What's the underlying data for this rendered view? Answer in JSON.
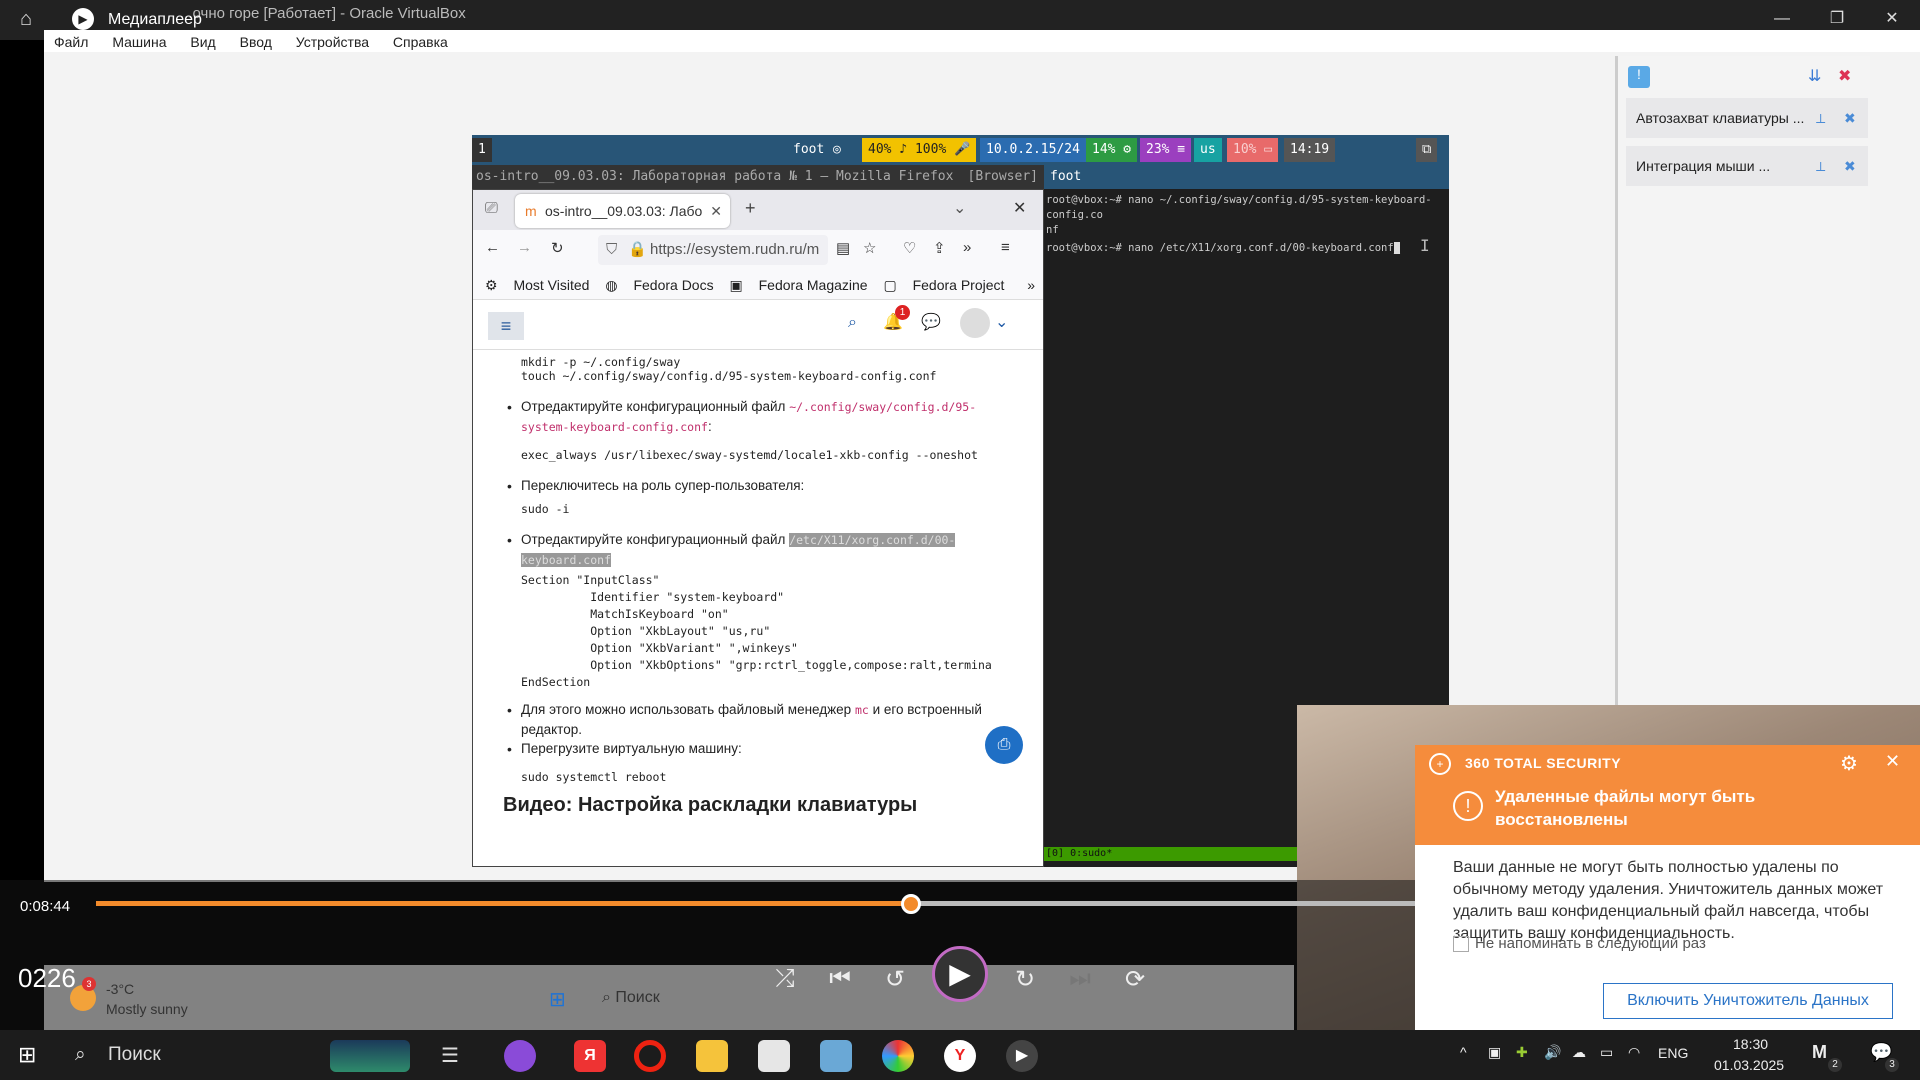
{
  "player": {
    "title": "Медиаплеер",
    "behind_title": "...очно горе [Работает] - Oracle VirtualBox",
    "current_time": "0:08:44",
    "clock_overlay": "0226",
    "progress_fraction": 0.45,
    "accent": "#f38b2b"
  },
  "vbox": {
    "menu": [
      "Файл",
      "Машина",
      "Вид",
      "Ввод",
      "Устройства",
      "Справка"
    ],
    "side_items": [
      "Автозахват клавиатуры ...",
      "Интеграция мыши ..."
    ]
  },
  "sway": {
    "workspace": "1",
    "foot": "foot",
    "audio": "40%",
    "volume": "100%",
    "ip": "10.0.2.15/24",
    "cpu": "14%",
    "mem": "23%",
    "layout": "us",
    "battery": "10%",
    "time": "14:19"
  },
  "firefox": {
    "window_title": "os-intro__09.03.03: Лабораторная работа № 1 — Mozilla Firefox",
    "window_tag": "[Browser]",
    "tab_label": "os-intro__09.03.03: Лабо",
    "url": "https://esystem.rudn.ru/m",
    "bookmarks": [
      "Most Visited",
      "Fedora Docs",
      "Fedora Magazine",
      "Fedora Project"
    ],
    "notif_count": "1"
  },
  "page": {
    "code1": "mkdir -p ~/.config/sway\ntouch ~/.config/sway/config.d/95-system-keyboard-config.conf",
    "b1_text": "Отредактируйте конфигурационный файл ",
    "b1_path": "~/.config/sway/config.d/95-system-keyboard-config.conf",
    "code2": "exec_always /usr/libexec/sway-systemd/locale1-xkb-config --oneshot",
    "b2_text": "Переключитесь на роль супер-пользователя:",
    "code3": "sudo -i",
    "b3_text": "Отредактируйте конфигурационный файл ",
    "b3_path": "/etc/X11/xorg.conf.d/00-keyboard.conf",
    "code4": "Section \"InputClass\"\n          Identifier \"system-keyboard\"\n          MatchIsKeyboard \"on\"\n          Option \"XkbLayout\" \"us,ru\"\n          Option \"XkbVariant\" \",winkeys\"\n          Option \"XkbOptions\" \"grp:rctrl_toggle,compose:ralt,termina\nEndSection",
    "b4_text": "Для этого можно использовать файловый менеджер ",
    "b4_mc": "mc",
    "b4_rest": " и его встроенный редактор.",
    "b5_text": "Перегрузите виртуальную машину:",
    "code5": "sudo systemctl reboot",
    "cut_heading": "Видео: Настройка раскладки клавиатуры"
  },
  "terminal": {
    "title": "foot",
    "line1": "root@vbox:~# nano ~/.config/sway/config.d/95-system-keyboard-config.co",
    "line2": "nf",
    "line3": "root@vbox:~# nano /etc/X11/xorg.conf.d/00-keyboard.conf",
    "status": "[0] 0:sudo*"
  },
  "security": {
    "brand": "360 TOTAL SECURITY",
    "title": "Удаленные файлы могут быть восстановлены",
    "body": "Ваши данные не могут быть полностью удалены по обычному методу удаления. Уничтожитель данных может удалить ваш конфиденциальный файл навсегда, чтобы защитить вашу конфиденциальность.",
    "checkbox": "Не напоминать в следующий раз",
    "button": "Включить Уничтожитель Данных",
    "color": "#f58c3c"
  },
  "guest_taskbar": {
    "weather_temp": "-3°C",
    "weather_desc": "Mostly sunny",
    "weather_badge": "3",
    "search": "Поиск"
  },
  "taskbar": {
    "search": "Поиск",
    "lang": "ENG",
    "time": "18:30",
    "date": "01.03.2025",
    "notif_count": "3",
    "badge2": "2"
  }
}
